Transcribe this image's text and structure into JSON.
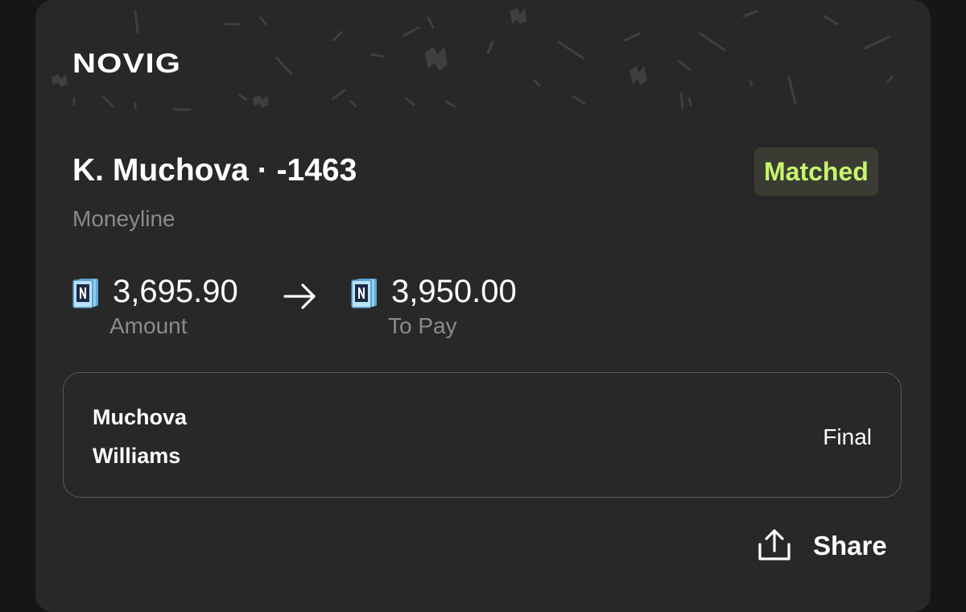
{
  "brand": {
    "logo_text": "NOVIG"
  },
  "bet": {
    "selection": "K. Muchova",
    "separator": "·",
    "odds": "-1463",
    "market": "Moneyline",
    "status_badge": "Matched"
  },
  "amounts": {
    "stake_value": "3,695.90",
    "stake_label": "Amount",
    "payout_value": "3,950.00",
    "payout_label": "To Pay",
    "currency_icon": "novig-coin-icon",
    "arrow_icon": "arrow-right-icon"
  },
  "game": {
    "team_1": "Muchova",
    "team_2": "Williams",
    "status": "Final"
  },
  "actions": {
    "share_label": "Share",
    "share_icon": "share-upload-icon"
  },
  "colors": {
    "background": "#161616",
    "card": "#282828",
    "badge_bg": "#3a3c33",
    "badge_text": "#c7f56f",
    "muted_text": "#8b8b8b",
    "coin_blue": "#7fc4ec"
  }
}
